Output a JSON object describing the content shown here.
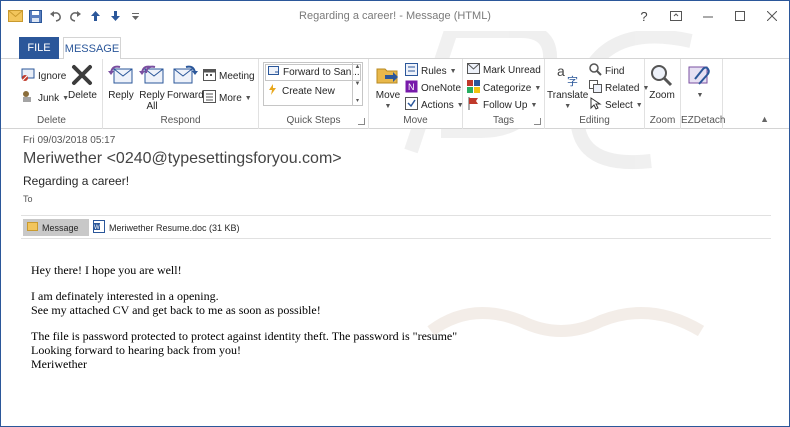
{
  "window": {
    "title": "Regarding a career! - Message (HTML)",
    "controls": [
      "?",
      "restore",
      "minimize",
      "maximize",
      "close"
    ]
  },
  "quick_access": [
    "mail-icon",
    "save-icon",
    "undo-icon",
    "redo-icon",
    "up-arrow-icon",
    "down-arrow-icon",
    "customize-icon"
  ],
  "tabs": {
    "file": "FILE",
    "message": "MESSAGE"
  },
  "ribbon": {
    "delete_group": {
      "label": "Delete",
      "ignore": "Ignore",
      "junk": "Junk",
      "delete": "Delete"
    },
    "respond_group": {
      "label": "Respond",
      "reply": "Reply",
      "reply_all_1": "Reply",
      "reply_all_2": "All",
      "forward": "Forward",
      "meeting": "Meeting",
      "more": "More"
    },
    "quick_steps_group": {
      "label": "Quick Steps",
      "item1": "Forward to San...",
      "item2": "Create New"
    },
    "move_group": {
      "label": "Move",
      "move": "Move",
      "rules": "Rules",
      "onenote": "OneNote",
      "actions": "Actions"
    },
    "tags_group": {
      "label": "Tags",
      "mark_unread": "Mark Unread",
      "categorize": "Categorize",
      "follow_up": "Follow Up"
    },
    "editing_group": {
      "label": "Editing",
      "translate": "Translate",
      "find": "Find",
      "related": "Related",
      "select": "Select"
    },
    "zoom_group": {
      "label": "Zoom",
      "zoom": "Zoom"
    },
    "ezdetach_group": {
      "label": "EZDetach"
    }
  },
  "message": {
    "sent_date": "Fri 09/03/2018 05:17",
    "from": "Meriwether <0240@typesettingsforyou.com>",
    "subject": "Regarding a career!",
    "to_label": "To",
    "attachments": {
      "message_tab": "Message",
      "file": "Meriwether Resume.doc (31 KB)"
    },
    "body": {
      "line1": "Hey there! I hope you are well!",
      "line2": "I am definately interested in a opening.",
      "line3": "See my attached CV and get back to me as soon as possible!",
      "line4": "The file is password protected to protect against identity theft. The password is \"resume\"",
      "line5": "Looking forward to hearing back from you!",
      "line6": "Meriwether"
    }
  },
  "colors": {
    "accent": "#2b579a",
    "watermark": "#e8e8e8"
  }
}
